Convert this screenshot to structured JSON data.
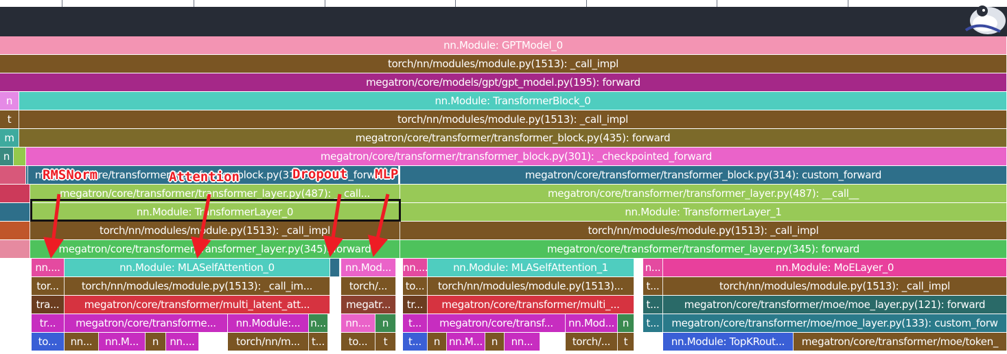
{
  "profile": {
    "rows": [
      [
        {
          "label": "nn.Module: GPTModel_0",
          "color": "#f394b3"
        }
      ],
      [
        {
          "label": "torch/nn/modules/module.py(1513): _call_impl",
          "color": "#7a5523"
        }
      ],
      [
        {
          "label": "megatron/core/models/gpt/gpt_model.py(195): forward",
          "color": "#a52888"
        }
      ],
      [
        {
          "label": "n",
          "color": "#e58ae6"
        },
        {
          "label": "nn.Module: TransformerBlock_0",
          "color": "#4fcdbf"
        }
      ],
      [
        {
          "label": "t",
          "color": "#7a5523"
        },
        {
          "label": "torch/nn/modules/module.py(1513): _call_impl",
          "color": "#7a5523"
        }
      ],
      [
        {
          "label": "m",
          "color": "#3eaa9e"
        },
        {
          "label": "megatron/core/transformer/transformer_block.py(435): forward",
          "color": "#7c6a2a"
        }
      ],
      [
        {
          "label": "n",
          "color": "#3a8a80"
        },
        {
          "label": "",
          "color": "#94c94c"
        },
        {
          "label": "megatron/core/transformer/transformer_block.py(301): _checkpointed_forward",
          "color": "#ea63c9"
        }
      ],
      [
        {
          "label": "",
          "color": "#d8587a"
        },
        {
          "label": "",
          "color": "#2e6f8a"
        },
        {
          "label": "megatron/core/transformer/transformer_block.py(314): custom_forward",
          "color": "#2e6f8a"
        },
        {
          "label": "megatron/core/transformer/transformer_block.py(314): custom_forward",
          "color": "#2e6f8a"
        }
      ],
      [
        {
          "label": "",
          "color": "#cc3a5a"
        },
        {
          "label": "megatron/core/transformer/transformer_layer.py(487): __call...",
          "color": "#98c957"
        },
        {
          "label": "megatron/core/transformer/transformer_layer.py(487): __call__",
          "color": "#98c957"
        }
      ],
      [
        {
          "label": "",
          "color": "#2e6f8a"
        },
        {
          "label": "nn.Module: TransformerLayer_0",
          "color": "#98c957"
        },
        {
          "label": "nn.Module: TransformerLayer_1",
          "color": "#98c957"
        }
      ],
      [
        {
          "label": "",
          "color": "#c0562a"
        },
        {
          "label": "torch/nn/modules/module.py(1513): _call_impl",
          "color": "#7a5523"
        },
        {
          "label": "torch/nn/modules/module.py(1513): _call_impl",
          "color": "#7a5523"
        }
      ],
      [
        {
          "label": "",
          "color": "#e68aa0"
        },
        {
          "label": "megatron/core/transformer/transformer_layer.py(345): forward",
          "color": "#4ec25c"
        },
        {
          "label": "megatron/core/transformer/transformer_layer.py(345): forward",
          "color": "#4ec25c"
        }
      ],
      [
        {
          "label": "nn....",
          "color": "#e44aa0"
        },
        {
          "label": "nn.Module: MLASelfAttention_0",
          "color": "#4fcdbf"
        },
        {
          "label": "",
          "color": "#2e6f8a"
        },
        {
          "label": "nn.Mod...",
          "color": "#ea63c9"
        },
        {
          "label": "nn....",
          "color": "#e44aa0"
        },
        {
          "label": "nn.Module: MLASelfAttention_1",
          "color": "#4fcdbf"
        },
        {
          "label": "n...",
          "color": "#e44aa0"
        },
        {
          "label": "nn.Module: MoELayer_0",
          "color": "#e8409c"
        }
      ],
      [
        {
          "label": "tor...",
          "color": "#7a5523"
        },
        {
          "label": "torch/nn/modules/module.py(1513): _call_im...",
          "color": "#7a5523"
        },
        {
          "label": "torch/...",
          "color": "#7a5523"
        },
        {
          "label": "to...",
          "color": "#7a5523"
        },
        {
          "label": "torch/nn/modules/module.py(1513)...",
          "color": "#7a5523"
        },
        {
          "label": "t...",
          "color": "#7a5523"
        },
        {
          "label": "torch/nn/modules/module.py(1513): _call_impl",
          "color": "#7a5523"
        }
      ],
      [
        {
          "label": "tra...",
          "color": "#6b3d20"
        },
        {
          "label": "megatron/core/transformer/multi_latent_att...",
          "color": "#d63340"
        },
        {
          "label": "megatr...",
          "color": "#8b4030"
        },
        {
          "label": "tr...",
          "color": "#6b3d20"
        },
        {
          "label": "megatron/core/transformer/multi_...",
          "color": "#d63340"
        },
        {
          "label": "t...",
          "color": "#2a6a68"
        },
        {
          "label": "megatron/core/transformer/moe/moe_layer.py(121): forward",
          "color": "#2a6a68"
        }
      ],
      [
        {
          "label": "tr...",
          "color": "#c72dc0"
        },
        {
          "label": "megatron/core/transforme...",
          "color": "#c72dc0"
        },
        {
          "label": "nn.Module:...",
          "color": "#c72dc0"
        },
        {
          "label": "n...",
          "color": "#3a8a50"
        },
        {
          "label": "nn....",
          "color": "#ea63c9"
        },
        {
          "label": "n",
          "color": "#3a8a50"
        },
        {
          "label": "t...",
          "color": "#c72dc0"
        },
        {
          "label": "megatron/core/transf...",
          "color": "#c72dc0"
        },
        {
          "label": "nn.Mod...",
          "color": "#c72dc0"
        },
        {
          "label": "n",
          "color": "#3a8a50"
        },
        {
          "label": "t...",
          "color": "#2a7a8a"
        },
        {
          "label": "megatron/core/transformer/moe/moe_layer.py(133): custom_forw",
          "color": "#2a7a8a"
        }
      ],
      [
        {
          "label": "to...",
          "color": "#3a5fd6"
        },
        {
          "label": "nn...",
          "color": "#7a5523"
        },
        {
          "label": "nn.M...",
          "color": "#c72dc0"
        },
        {
          "label": "n",
          "color": "#7a5523"
        },
        {
          "label": "nn....",
          "color": "#c72dc0"
        },
        {
          "label": "torch/nn/m...",
          "color": "#7a5523"
        },
        {
          "label": "t...",
          "color": "#7a5523"
        },
        {
          "label": "to...",
          "color": "#7a5523"
        },
        {
          "label": "t",
          "color": "#7a5523"
        },
        {
          "label": "t...",
          "color": "#3a5fd6"
        },
        {
          "label": "n",
          "color": "#7a5523"
        },
        {
          "label": "nn.M...",
          "color": "#c72dc0"
        },
        {
          "label": "n",
          "color": "#7a5523"
        },
        {
          "label": "nn...",
          "color": "#c72dc0"
        },
        {
          "label": "torch/...",
          "color": "#7a5523"
        },
        {
          "label": "t",
          "color": "#7a5523"
        },
        {
          "label": "nn.Module: TopKRout...",
          "color": "#3a5fd6"
        },
        {
          "label": "megatron/core/transformer/moe/token_",
          "color": "#7a5523"
        }
      ]
    ]
  },
  "annotations": {
    "rmsnorm": "RMSNorm",
    "attention": "Attention",
    "dropout": "Dropout",
    "mlp": "MLP"
  }
}
